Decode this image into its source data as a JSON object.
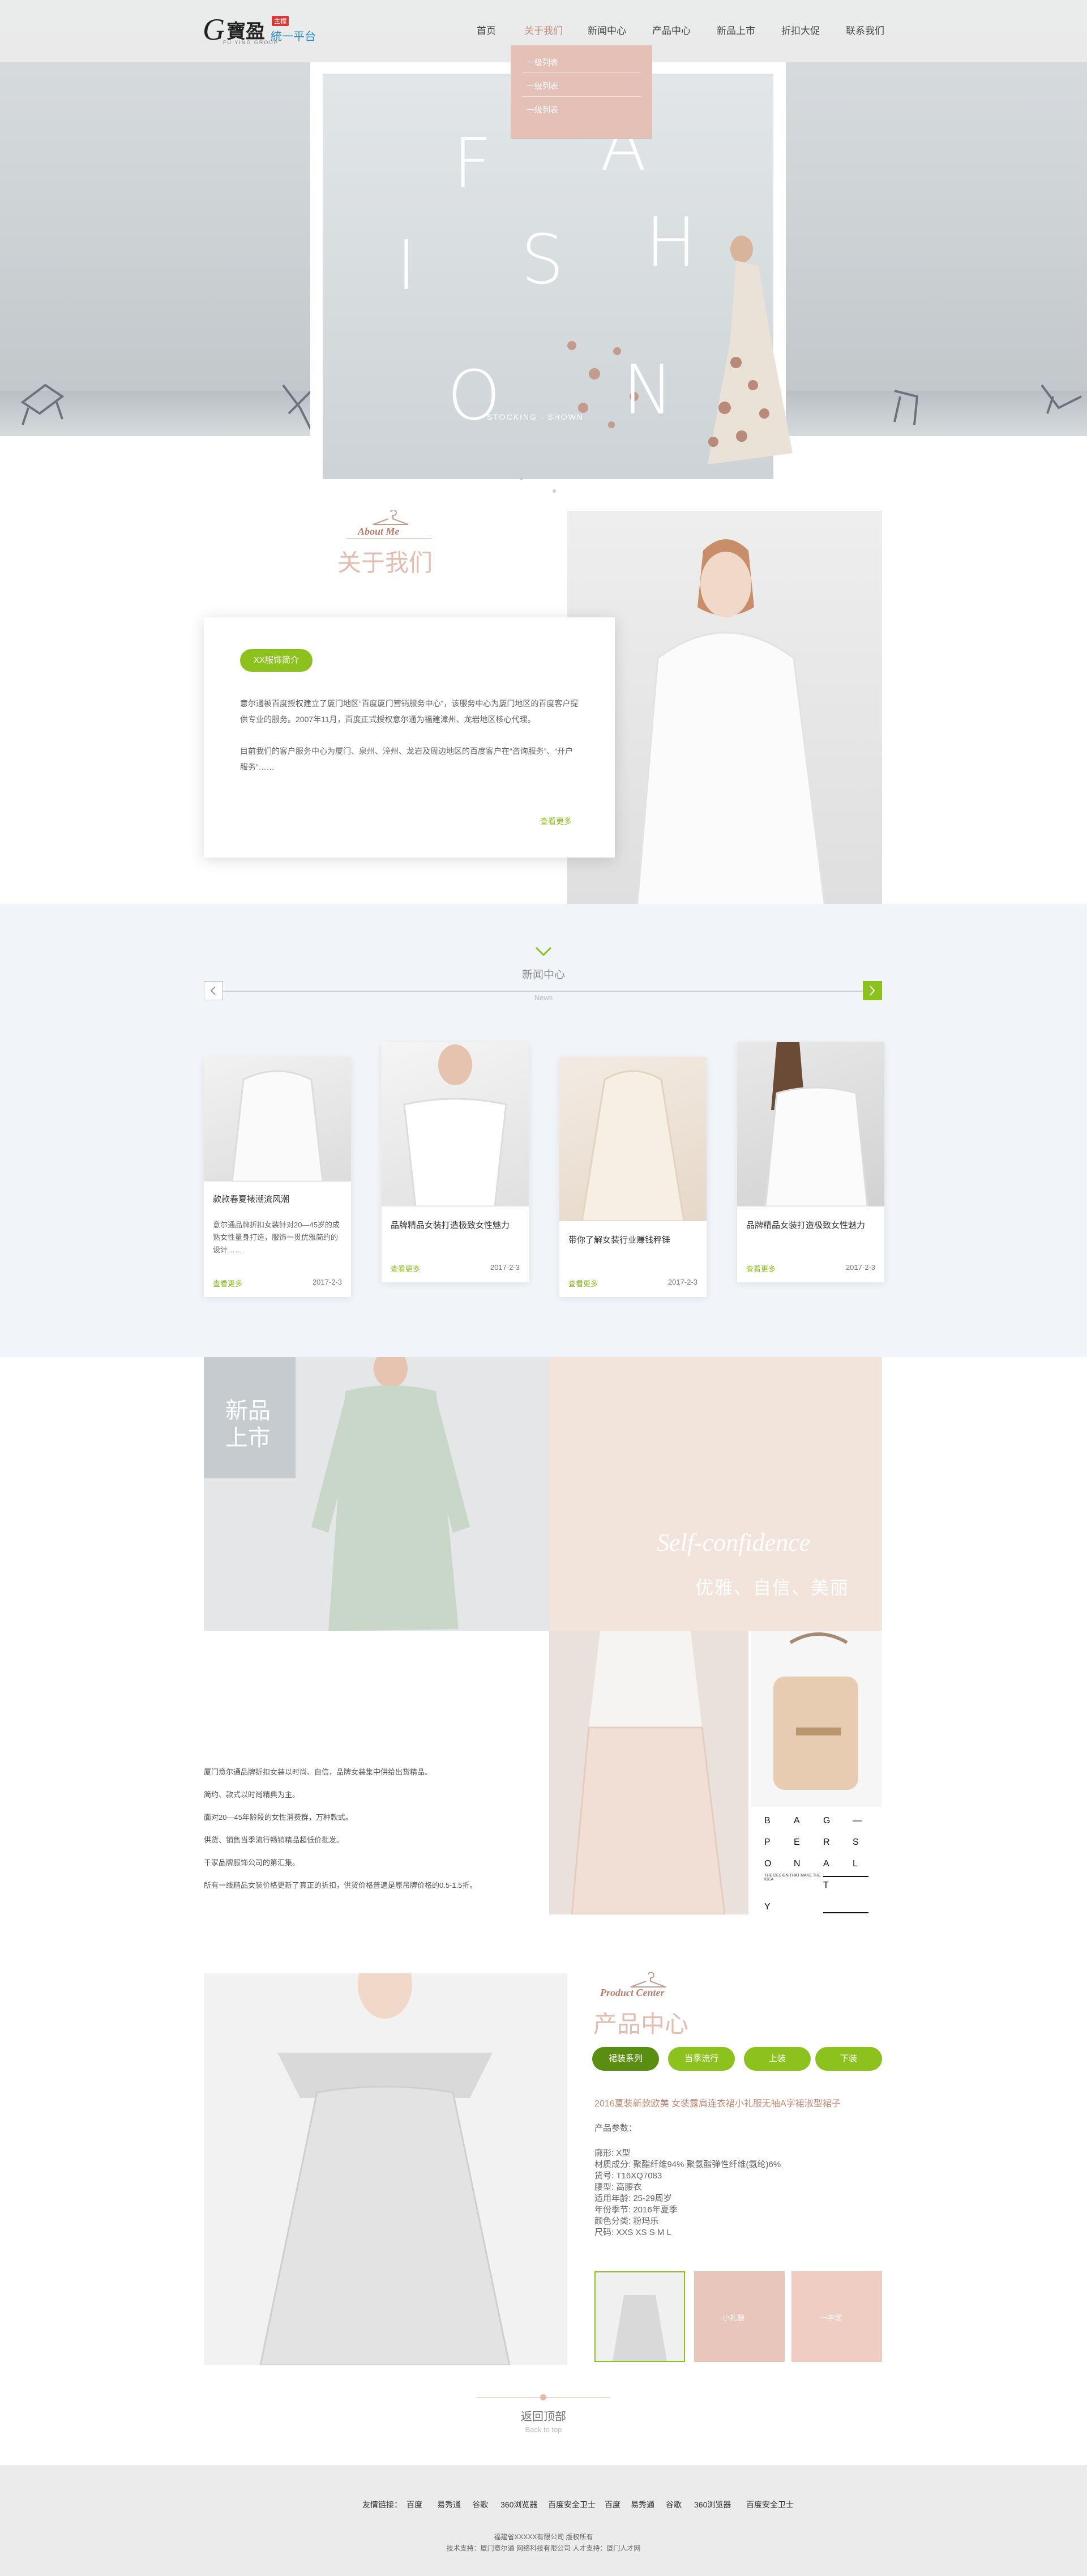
{
  "header": {
    "logo": {
      "letter": "G",
      "chinese": "寶盈",
      "badge": "主標",
      "platform": "統一平台",
      "tagline": "FU YING GROUP"
    },
    "nav": [
      "首页",
      "关于我们",
      "新闻中心",
      "产品中心",
      "新品上市",
      "折扣大促",
      "联系我们"
    ],
    "dropdown": [
      "一级列表",
      "一级列表",
      "一级列表"
    ]
  },
  "hero": {
    "letters": [
      "F",
      "A",
      "I",
      "S",
      "H",
      "O",
      "N"
    ],
    "tagline": "STOCKING · SHOWN"
  },
  "about": {
    "title_en": "About Me",
    "title_zh": "关于我们",
    "badge": "XX服饰简介",
    "paragraphs": [
      "意尔通被百度授权建立了厦门地区“百度厦门营销服务中心”，该服务中心为厦门地区的百度客户提供专业的服务。2007年11月，百度正式授权意尔通为福建漳州、龙岩地区核心代理。",
      "目前我们的客户服务中心为厦门、泉州、漳州、龙岩及周边地区的百度客户在“咨询服务”、“开户服务”……"
    ],
    "more": "查看更多"
  },
  "news": {
    "title_zh": "新闻中心",
    "title_en": "News",
    "items": [
      {
        "title": "款款春夏裱潮流风潮",
        "desc": "意尔通品牌折扣女装针对20—45岁的成熟女性量身打造，服饰一贯优雅简约的设计……",
        "more": "查看更多",
        "date": "2017-2-3"
      },
      {
        "title": "品牌精品女装打造极致女性魅力",
        "desc": "",
        "more": "查看更多",
        "date": "2017-2-3"
      },
      {
        "title": "带你了解女装行业赚钱秤锤",
        "desc": "",
        "more": "查看更多",
        "date": "2017-2-3"
      },
      {
        "title": "品牌精品女装打造极致女性魅力",
        "desc": "",
        "more": "查看更多",
        "date": "2017-2-3"
      }
    ]
  },
  "arrivals": {
    "label_line1": "新品",
    "label_line2": "上市",
    "script": "Self-confidence",
    "slogan": "优雅、自信、美丽",
    "paragraphs": [
      "厦门意尔通品牌折扣女装以时尚、自信，品牌女装集中供给出货精品。",
      "简约、款式以时尚精典为主。",
      "面对20—45年龄段的女性消费群，万种款式。",
      "供货、销售当季流行畅销精品超低价批发。",
      "千家品牌服饰公司的第汇集。",
      "所有一线精品女装价格更新了真正的折扣，供货价格普遍是原吊牌价格的0.5-1.5折。"
    ],
    "bag_letters": [
      "B",
      "A",
      "G",
      "—",
      "P",
      "E",
      "R",
      "S",
      "O",
      "N",
      "A",
      "L",
      "I",
      "T",
      "Y"
    ],
    "bag_note": "THE DESIGN THAT MAKE THE IDEA"
  },
  "product": {
    "title_en": "Product Center",
    "title_zh": "产品中心",
    "tabs": [
      "裙装系列",
      "当季流行",
      "上装",
      "下装"
    ],
    "name": "2016夏装新款欧美 女装露肩连衣裙小礼服无袖A字裙淑型裙子",
    "params_label": "产品参数：",
    "specs": [
      "廓形: X型",
      "材质成分: 聚酯纤维94% 聚氨酯弹性纤维(氨纶)6%",
      "货号: T16XQ7083",
      "腰型: 高腰衣",
      "适用年龄: 25-29周岁",
      "年份季节: 2016年夏季",
      "颜色分类: 粉玛乐",
      "尺码: XXS XS S M L"
    ],
    "thumb_labels": [
      "",
      "小礼服",
      "一字领"
    ]
  },
  "back_top": {
    "zh": "返回顶部",
    "en": "Back to top"
  },
  "footer": {
    "label": "友情链接：",
    "links": [
      "百度",
      "易秀通",
      "谷歌",
      "360浏览器",
      "百度安全卫士",
      "百度",
      "易秀通",
      "谷歌",
      "360浏览器",
      "百度安全卫士"
    ],
    "copyright": "福建省XXXXX有限公司 版权所有",
    "support": "技术支持：厦门意尔通 网络科技有限公司 人才支持：厦门人才网"
  }
}
